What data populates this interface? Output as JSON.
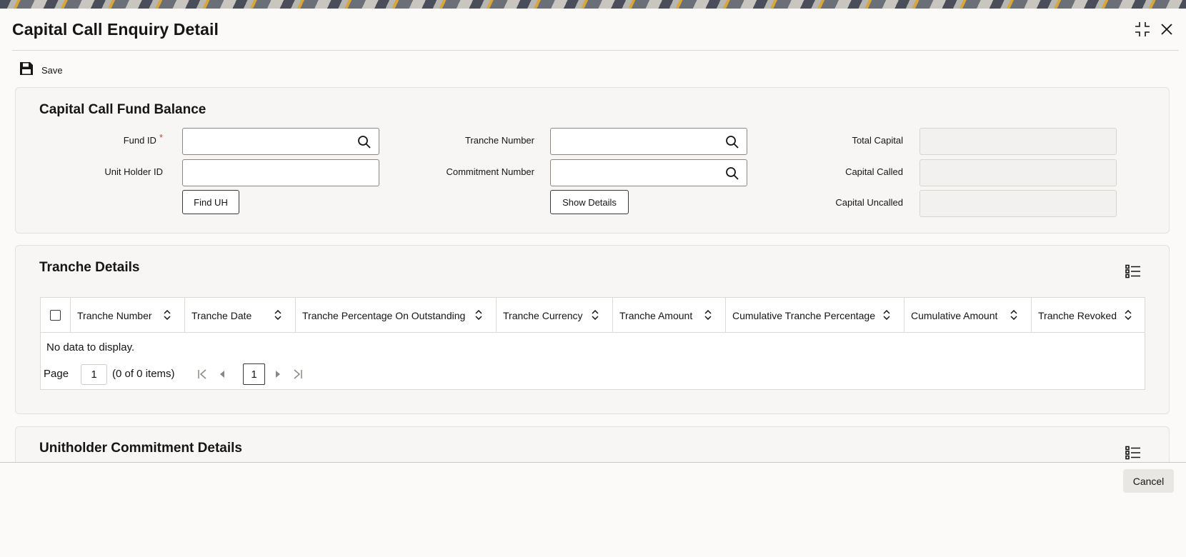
{
  "window": {
    "title": "Capital Call Enquiry Detail",
    "maximize_icon": "collapse-corners-icon",
    "close_icon": "close-icon"
  },
  "toolbar": {
    "save_label": "Save",
    "save_icon": "floppy-disk-icon"
  },
  "fund_balance": {
    "title": "Capital Call Fund Balance",
    "fund_id_label": "Fund ID",
    "required_mark": "*",
    "fund_id_value": "",
    "unit_holder_id_label": "Unit Holder ID",
    "unit_holder_id_value": "",
    "find_uh_label": "Find UH",
    "tranche_number_label": "Tranche Number",
    "tranche_number_value": "",
    "commitment_number_label": "Commitment Number",
    "commitment_number_value": "",
    "show_details_label": "Show Details",
    "total_capital_label": "Total Capital",
    "total_capital_value": "",
    "capital_called_label": "Capital Called",
    "capital_called_value": "",
    "capital_uncalled_label": "Capital Uncalled",
    "capital_uncalled_value": ""
  },
  "tranche_details": {
    "title": "Tranche Details",
    "columns": [
      "Tranche Number",
      "Tranche Date",
      "Tranche Percentage On Outstanding",
      "Tranche Currency",
      "Tranche Amount",
      "Cumulative Tranche Percentage",
      "Cumulative Amount",
      "Tranche Revoked"
    ],
    "rows": [],
    "empty_text": "No data to display.",
    "pager": {
      "page_label": "Page",
      "page_value": "1",
      "count_text": "(0 of 0 items)",
      "current_page": "1"
    }
  },
  "unitholder_commitment": {
    "title": "Unitholder Commitment Details"
  },
  "footer": {
    "cancel_label": "Cancel"
  },
  "colors": {
    "accent_required": "#c74634",
    "panel_bg": "#f7f6f4",
    "text": "#161513"
  }
}
